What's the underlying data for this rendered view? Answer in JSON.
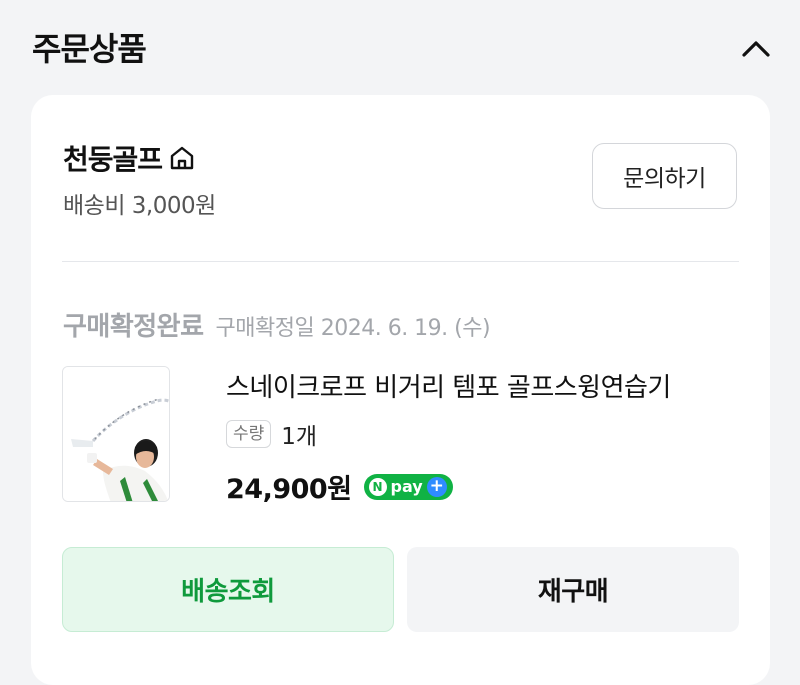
{
  "section": {
    "title": "주문상품",
    "collapse_icon": "chevron-up-icon"
  },
  "seller": {
    "name": "천둥골프",
    "home_icon": "home-icon",
    "shipping_fee": "배송비 3,000원",
    "inquiry_label": "문의하기"
  },
  "order": {
    "status": "구매확정완료",
    "confirm_date": "구매확정일 2024. 6. 19. (수)"
  },
  "product": {
    "name": "스네이크로프 비거리 템포 골프스윙연습기",
    "quantity_label": "수량",
    "quantity_value": "1개",
    "price": "24,900원",
    "npay_label": "pay",
    "npay_n": "N",
    "npay_plus": "+"
  },
  "actions": {
    "track_label": "배송조회",
    "rebuy_label": "재구매"
  },
  "colors": {
    "accent_green": "#0f9a3c",
    "track_bg": "#e6f8ec",
    "npay_green": "#10b244",
    "npay_blue": "#2f8cff"
  }
}
